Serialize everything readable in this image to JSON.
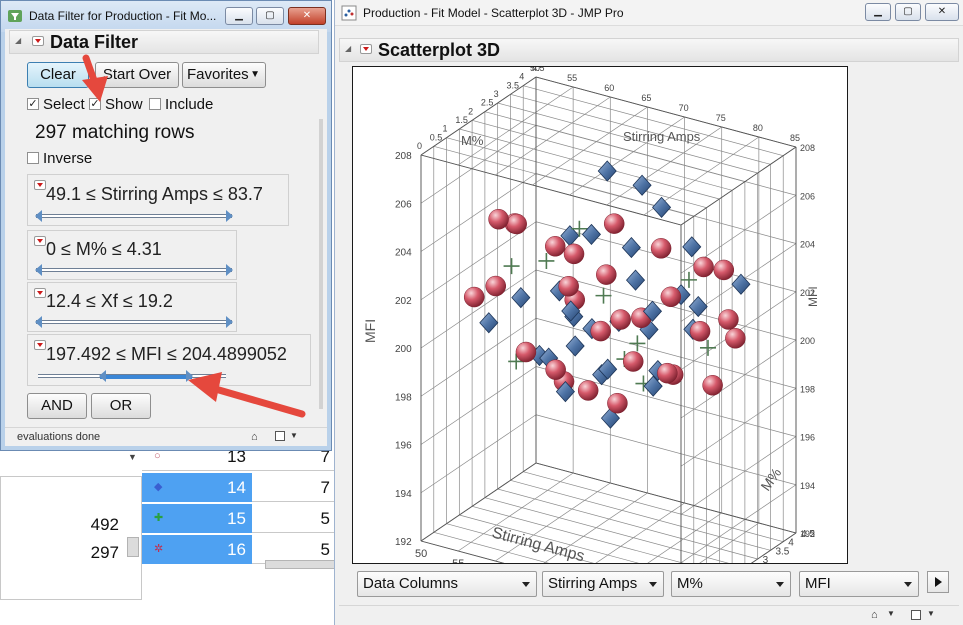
{
  "background_table": {
    "row_numbers": [
      "13",
      "14",
      "15",
      "16"
    ],
    "row_values": [
      "7",
      "7",
      "5",
      "5"
    ],
    "selected_rows": [
      false,
      true,
      true,
      true
    ],
    "side_values": [
      "492",
      "297"
    ]
  },
  "filter_window": {
    "title": "Data Filter for Production - Fit Mo...",
    "header": "Data Filter",
    "buttons": {
      "clear": "Clear",
      "start_over": "Start Over",
      "favorites": "Favorites",
      "and": "AND",
      "or": "OR"
    },
    "checkboxes": {
      "select": {
        "label": "Select",
        "checked": true
      },
      "show": {
        "label": "Show",
        "checked": true
      },
      "include": {
        "label": "Include",
        "checked": false
      },
      "inverse": {
        "label": "Inverse",
        "checked": false
      }
    },
    "matching_rows": "297 matching rows",
    "filters": [
      {
        "label": "49.1 ≤ Stirring Amps ≤ 83.7",
        "low": 0.0,
        "high": 1.0
      },
      {
        "label": "0 ≤ M% ≤ 4.31",
        "low": 0.0,
        "high": 1.0
      },
      {
        "label": "12.4 ≤ Xf ≤ 19.2",
        "low": 0.0,
        "high": 1.0
      },
      {
        "label": "197.492 ≤ MFI ≤ 204.4899052",
        "low": 0.33,
        "high": 0.82
      }
    ],
    "status": "evaluations done"
  },
  "plot_window": {
    "title": "Production - Fit Model - Scatterplot 3D - JMP Pro",
    "header": "Scatterplot 3D",
    "combos": {
      "data_columns": "Data Columns",
      "x": "Stirring Amps",
      "y": "M%",
      "z": "MFI"
    }
  },
  "chart_data": {
    "type": "scatter",
    "axes": {
      "x": {
        "label": "Stirring Amps",
        "ticks": [
          "50",
          "55",
          "60",
          "65",
          "70",
          "75",
          "80",
          "85"
        ],
        "range": [
          50,
          85
        ]
      },
      "y": {
        "label": "M%",
        "ticks": [
          "0",
          "0.5",
          "1",
          "1.5",
          "2",
          "2.5",
          "3",
          "3.5",
          "4",
          "4.5"
        ],
        "range": [
          0,
          4.5
        ]
      },
      "z": {
        "label": "MFI",
        "ticks": [
          "192",
          "194",
          "196",
          "198",
          "200",
          "202",
          "204",
          "206",
          "208"
        ],
        "range": [
          192,
          208
        ]
      }
    },
    "series": [
      {
        "marker": "sphere",
        "color": "#d95a6c",
        "points": [
          [
            57,
            1.0,
            205.2
          ],
          [
            62,
            2.5,
            203.1
          ],
          [
            65,
            3.2,
            204.1
          ],
          [
            72,
            3.0,
            203.8
          ],
          [
            52,
            1.5,
            201.2
          ],
          [
            60,
            1.2,
            199.8
          ],
          [
            70,
            2.0,
            201.4
          ],
          [
            76,
            3.5,
            203.0
          ],
          [
            68,
            1.8,
            200.9
          ],
          [
            74,
            2.8,
            202.1
          ],
          [
            80,
            2.2,
            201.6
          ],
          [
            58,
            0.6,
            202.8
          ],
          [
            63,
            2.0,
            202.2
          ],
          [
            66,
            2.6,
            202.5
          ],
          [
            55,
            3.8,
            201.9
          ],
          [
            78,
            1.5,
            200.2
          ],
          [
            82,
            3.0,
            200.9
          ],
          [
            64,
            1.2,
            199.4
          ],
          [
            69,
            3.1,
            200.6
          ],
          [
            73,
            1.0,
            198.9
          ],
          [
            61,
            2.4,
            197.8
          ],
          [
            67,
            1.6,
            198.5
          ],
          [
            71,
            2.2,
            199.6
          ],
          [
            59,
            3.4,
            200.3
          ],
          [
            75,
            2.6,
            199.1
          ],
          [
            77,
            4.0,
            202.6
          ],
          [
            53,
            2.8,
            203.4
          ],
          [
            56,
            2.0,
            204.2
          ],
          [
            79,
            3.6,
            201.0
          ],
          [
            81,
            2.4,
            199.3
          ]
        ]
      },
      {
        "marker": "diamond",
        "color": "#4f74a6",
        "points": [
          [
            62,
            3.8,
            205.6
          ],
          [
            66,
            4.0,
            205.2
          ],
          [
            70,
            3.6,
            204.9
          ],
          [
            64,
            2.6,
            204.0
          ],
          [
            68,
            3.0,
            203.5
          ],
          [
            72,
            2.0,
            203.2
          ],
          [
            76,
            1.5,
            202.6
          ],
          [
            60,
            1.0,
            202.2
          ],
          [
            58,
            3.5,
            202.8
          ],
          [
            74,
            3.2,
            201.9
          ],
          [
            78,
            2.5,
            201.3
          ],
          [
            65,
            1.5,
            201.7
          ],
          [
            63,
            2.2,
            200.8
          ],
          [
            67,
            2.8,
            200.5
          ],
          [
            71,
            1.2,
            200.0
          ],
          [
            75,
            2.0,
            199.7
          ],
          [
            69,
            3.4,
            199.9
          ],
          [
            61,
            1.8,
            199.2
          ],
          [
            66,
            1.0,
            198.8
          ],
          [
            73,
            2.4,
            198.6
          ],
          [
            57,
            2.6,
            198.4
          ],
          [
            64,
            3.0,
            197.9
          ],
          [
            70,
            1.6,
            197.6
          ],
          [
            77,
            3.0,
            201.8
          ],
          [
            80,
            3.8,
            202.4
          ],
          [
            55,
            1.2,
            200.6
          ],
          [
            59,
            2.8,
            201.1
          ],
          [
            72,
            4.2,
            203.0
          ],
          [
            68,
            0.8,
            201.0
          ],
          [
            62,
            3.2,
            199.5
          ]
        ]
      },
      {
        "marker": "plus",
        "color": "#4f7a52",
        "points": [
          [
            56,
            1.8,
            202.6
          ],
          [
            61,
            3.0,
            203.7
          ],
          [
            67,
            2.2,
            202.0
          ],
          [
            73,
            3.8,
            202.0
          ],
          [
            58,
            1.4,
            199.1
          ],
          [
            79,
            2.8,
            200.4
          ],
          [
            65,
            3.6,
            198.2
          ],
          [
            71,
            2.6,
            198.4
          ],
          [
            60,
            2.0,
            203.0
          ],
          [
            75,
            1.2,
            201.4
          ]
        ]
      }
    ]
  }
}
